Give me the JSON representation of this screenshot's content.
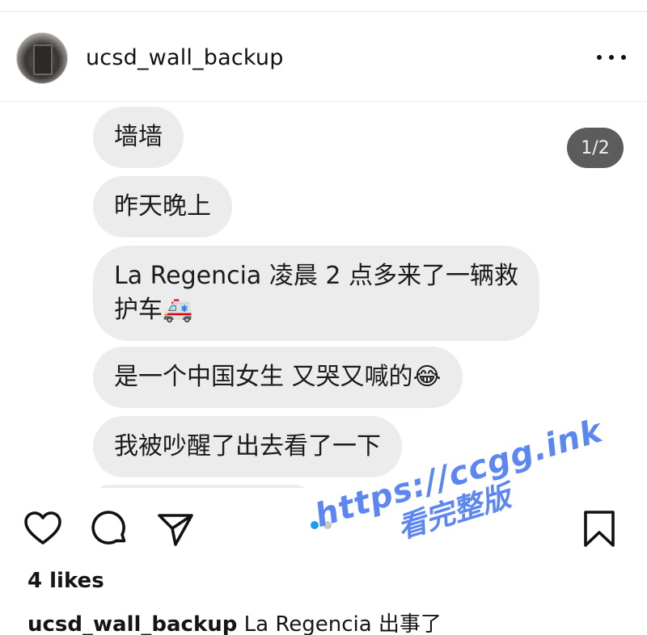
{
  "header": {
    "username": "ucsd_wall_backup",
    "more_icon": "more-horizontal-icon"
  },
  "media": {
    "counter": "1/2",
    "messages": [
      "墙墙",
      "昨天晚上",
      "La Regencia 凌晨 2 点多来了一辆救\n护车🚑",
      "是一个中国女生 又哭又喊的😂",
      "我被吵醒了出去看了一下"
    ],
    "carousel_position": 1,
    "carousel_total": 2
  },
  "actions": {
    "like_icon": "heart-icon",
    "comment_icon": "comment-icon",
    "share_icon": "send-icon",
    "save_icon": "bookmark-icon"
  },
  "watermark": {
    "line1": "https://ccgg.ink",
    "line2": "看完整版",
    "color": "#4f7df0"
  },
  "post": {
    "likes": "4 likes",
    "caption_user": "ucsd_wall_backup",
    "caption_text": " La Regencia 出事了"
  },
  "colors": {
    "bubble": "#ececec",
    "counter_bg": "#5c5c5c",
    "active_dot": "#1d9bf0"
  }
}
